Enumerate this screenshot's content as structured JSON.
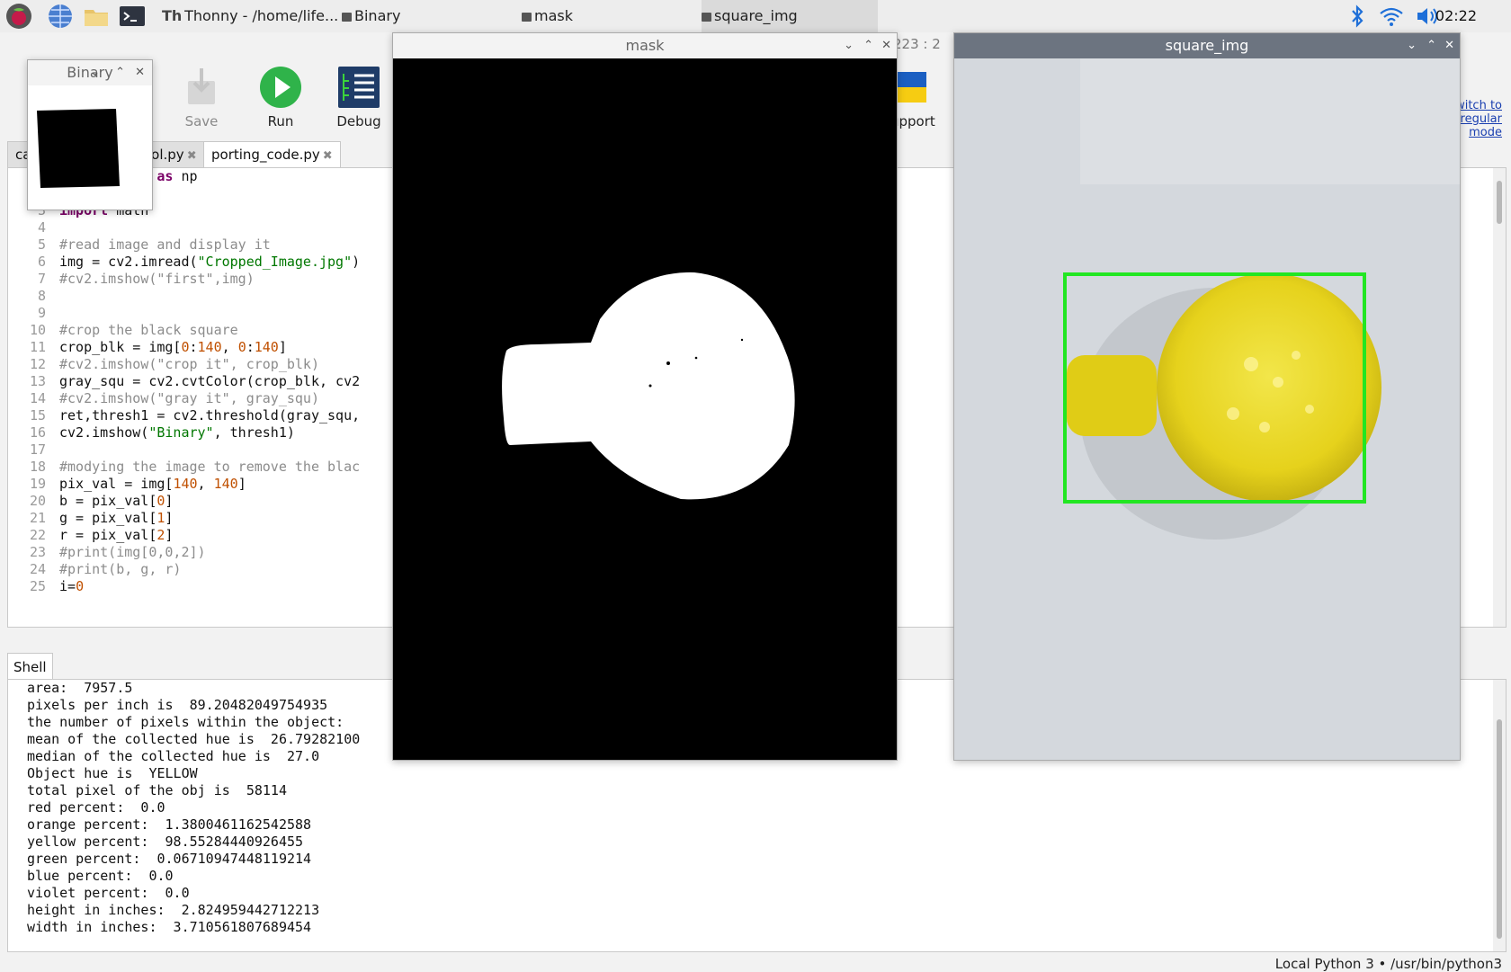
{
  "taskbar": {
    "tasks": [
      {
        "label": "Thonny  -  /home/life..."
      },
      {
        "label": "Binary"
      },
      {
        "label": "mask"
      },
      {
        "label": "square_img"
      }
    ],
    "clock": "02:22"
  },
  "toolbar": {
    "save_label": "Save",
    "run_label": "Run",
    "debug_label": "Debug",
    "support_label": "upport",
    "coords_label": "223 : 2",
    "switch_mode_label": "witch to regular mode"
  },
  "editor_tabs": [
    {
      "label": "ca"
    },
    {
      "label": "ool.py"
    },
    {
      "label": "porting_code.py"
    }
  ],
  "code_lines": [
    {
      "num": "",
      "html": "         py <span class=\"kw\">as</span> np"
    },
    {
      "num": "",
      "html": ""
    },
    {
      "num": "3",
      "html": "<span class=\"kw\">import</span> math"
    },
    {
      "num": "4",
      "html": ""
    },
    {
      "num": "5",
      "html": "<span class=\"cm\">#read image and display it</span>"
    },
    {
      "num": "6",
      "html": "img = cv2.imread(<span class=\"st\">\"Cropped_Image.jpg\"</span>)"
    },
    {
      "num": "7",
      "html": "<span class=\"cm\">#cv2.imshow(\"first\",img)</span>"
    },
    {
      "num": "8",
      "html": ""
    },
    {
      "num": "9",
      "html": ""
    },
    {
      "num": "10",
      "html": "<span class=\"cm\">#crop the black square</span>"
    },
    {
      "num": "11",
      "html": "crop_blk = img[<span class=\"nm\">0</span>:<span class=\"nm\">140</span>, <span class=\"nm\">0</span>:<span class=\"nm\">140</span>]"
    },
    {
      "num": "12",
      "html": "<span class=\"cm\">#cv2.imshow(\"crop it\", crop_blk)</span>"
    },
    {
      "num": "13",
      "html": "gray_squ = cv2.cvtColor(crop_blk, cv2"
    },
    {
      "num": "14",
      "html": "<span class=\"cm\">#cv2.imshow(\"gray it\", gray_squ)</span>"
    },
    {
      "num": "15",
      "html": "ret,thresh1 = cv2.threshold(gray_squ,"
    },
    {
      "num": "16",
      "html": "cv2.imshow(<span class=\"st\">\"Binary\"</span>, thresh1)"
    },
    {
      "num": "17",
      "html": ""
    },
    {
      "num": "18",
      "html": "<span class=\"cm\">#modying the image to remove the blac</span>"
    },
    {
      "num": "19",
      "html": "pix_val = img[<span class=\"nm\">140</span>, <span class=\"nm\">140</span>]"
    },
    {
      "num": "20",
      "html": "b = pix_val[<span class=\"nm\">0</span>]"
    },
    {
      "num": "21",
      "html": "g = pix_val[<span class=\"nm\">1</span>]"
    },
    {
      "num": "22",
      "html": "r = pix_val[<span class=\"nm\">2</span>]"
    },
    {
      "num": "23",
      "html": "<span class=\"cm\">#print(img[0,0,2])</span>"
    },
    {
      "num": "24",
      "html": "<span class=\"cm\">#print(b, g, r)</span>"
    },
    {
      "num": "25",
      "html": "i=<span class=\"nm\">0</span>"
    }
  ],
  "shell": {
    "tab_label": "Shell",
    "lines": [
      "area:  7957.5",
      "pixels per inch is  89.20482049754935",
      "the number of pixels within the object:",
      "mean of the collected hue is  26.79282100",
      "median of the collected hue is  27.0",
      "Object hue is  YELLOW",
      "total pixel of the obj is  58114",
      "red percent:  0.0",
      "orange percent:  1.3800461162542588",
      "yellow percent:  98.55284440926455",
      "green percent:  0.06710947448119214",
      "blue percent:  0.0",
      "violet percent:  0.0",
      "height in inches:  2.824959442712213",
      "width in inches:  3.710561807689454"
    ]
  },
  "status": "Local Python 3  •  /usr/bin/python3",
  "windows": {
    "binary_title": "Binary",
    "mask_title": "mask",
    "square_title": "square_img"
  },
  "colors": {
    "run_green": "#2fb34a",
    "bbox_green": "#22e622",
    "object_yellow": "#e8d61c"
  }
}
